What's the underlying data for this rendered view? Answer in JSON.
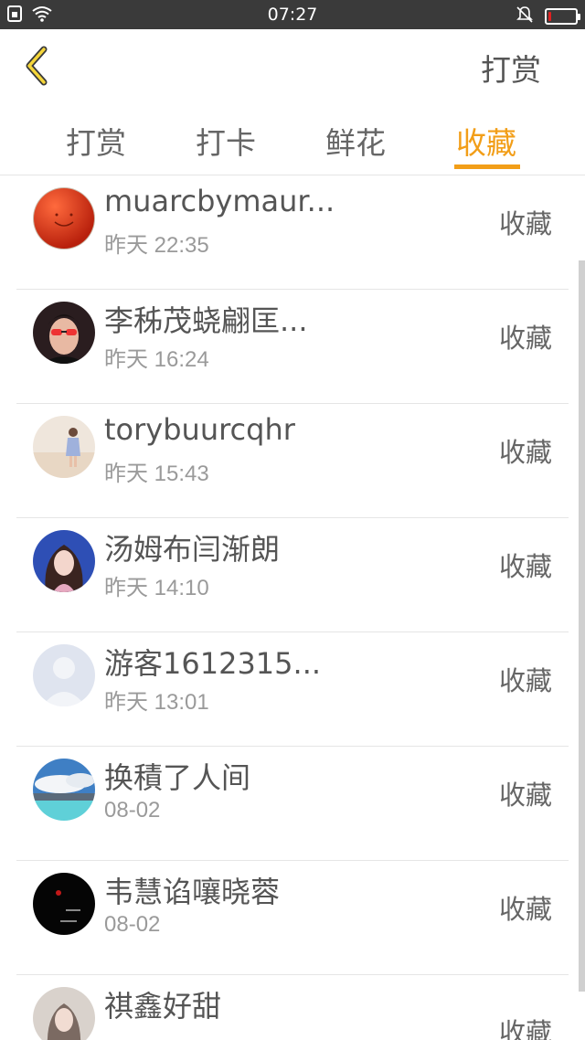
{
  "status_bar": {
    "time": "07:27",
    "icons": [
      "sim-icon",
      "wifi-icon",
      "mute-icon",
      "battery-icon"
    ],
    "battery_level": 0.12,
    "battery_color": "#e02020"
  },
  "header": {
    "back_icon": "chevron-left-icon",
    "action_label": "打赏"
  },
  "tabs": [
    {
      "label": "打赏",
      "active": false
    },
    {
      "label": "打卡",
      "active": false
    },
    {
      "label": "鲜花",
      "active": false
    },
    {
      "label": "收藏",
      "active": true
    }
  ],
  "accent_color": "#f29e18",
  "list": [
    {
      "name": "muarcbymaur...",
      "time": "昨天 22:35",
      "action": "收藏",
      "avatar": "red-ball-avatar"
    },
    {
      "name": "李秭茂蛲翩匡...",
      "time": "昨天 16:24",
      "action": "收藏",
      "avatar": "man-sunglasses-avatar"
    },
    {
      "name": "torybuurcqhr",
      "time": "昨天 15:43",
      "action": "收藏",
      "avatar": "girl-beach-avatar"
    },
    {
      "name": "汤姆布闫渐朗",
      "time": "昨天 14:10",
      "action": "收藏",
      "avatar": "anime-girl-avatar"
    },
    {
      "name": "游客1612315...",
      "time": "昨天 13:01",
      "action": "收藏",
      "avatar": "default-user-avatar"
    },
    {
      "name": "换積了人间",
      "time": "08-02",
      "action": "收藏",
      "avatar": "sky-landscape-avatar"
    },
    {
      "name": "韦慧谄嚷晓蓉",
      "time": "08-02",
      "action": "收藏",
      "avatar": "black-text-avatar"
    },
    {
      "name": "祺鑫好甜",
      "time": "",
      "action": "收藏",
      "avatar": "girl-photo-avatar"
    }
  ]
}
